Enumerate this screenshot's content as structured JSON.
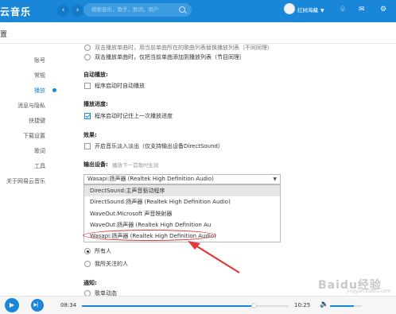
{
  "app": {
    "name": "云音乐"
  },
  "search": {
    "placeholder": "搜索音乐，歌手，歌词，用户"
  },
  "user": {
    "name": "红树海藏"
  },
  "page": {
    "title": "置"
  },
  "sidebar": {
    "items": [
      {
        "label": "账号"
      },
      {
        "label": "常规"
      },
      {
        "label": "播放",
        "active": true
      },
      {
        "label": "消息与隐私"
      },
      {
        "label": "快捷键"
      },
      {
        "label": "下载设置"
      },
      {
        "label": "歌词"
      },
      {
        "label": "工具"
      },
      {
        "label": "关于网易云音乐"
      }
    ]
  },
  "settings": {
    "dblclick_partial": "双击播放单曲时，用当前单曲所在的歌曲列表替换播放列表（不同同理）",
    "dblclick_option": "双击播放单曲时，仅把当前单曲添加到播放列表（节目同理）",
    "autoplay": {
      "title": "自动播放:",
      "option": "程序启动时自动播放"
    },
    "progress": {
      "title": "播放进度:",
      "option": "程序启动时记住上一次播放进度"
    },
    "effects": {
      "title": "效果:",
      "option": "开启音乐淡入淡出（仅支持输出设备DirectSound）"
    },
    "output": {
      "title": "输出设备:",
      "note": "播放下一首歌时生效",
      "selected": "Wasapi:扬声器 (Realtek High Definition Audio)",
      "options": [
        "DirectSound:主声音驱动程序",
        "DirectSound:扬声器 (Realtek High Definition Audio)",
        "WaveOut:Microsoft 声音映射器",
        "WaveOut:扬声器 (Realtek High Definition Au",
        "Wasapi:扬声器 (Realtek High Definition Audio)"
      ]
    },
    "privacy_options": [
      "所有人",
      "我所关注的人"
    ],
    "notify": {
      "title": "通知:",
      "option": "歌单动态"
    }
  },
  "player": {
    "current_time": "08:34",
    "total_time": "10:25",
    "progress": 0.83,
    "volume": 0.75
  },
  "watermark": {
    "text": "Baidu经验",
    "sub": "jingyan.baidu.com"
  },
  "colors": {
    "accent": "#1a86d8",
    "annotation": "#e23a3a"
  }
}
